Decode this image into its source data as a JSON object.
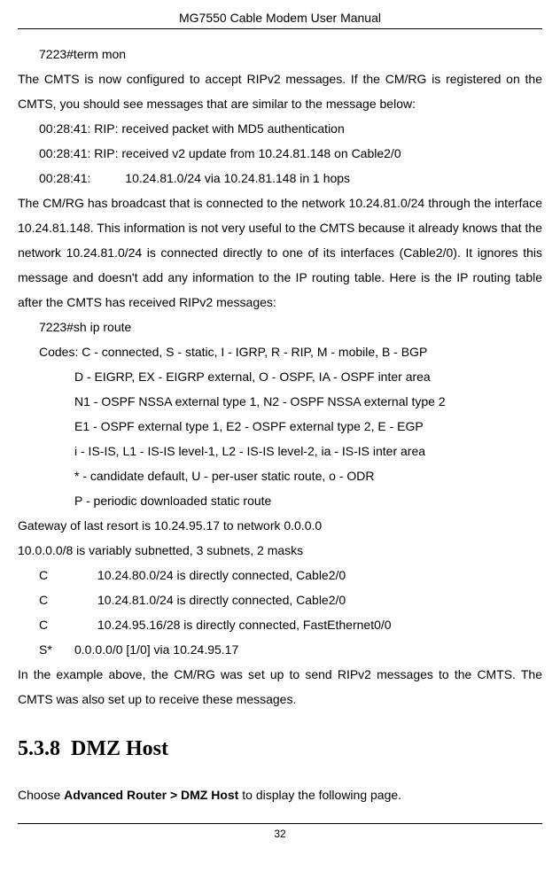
{
  "header": {
    "title": "MG7550 Cable Modem User Manual"
  },
  "body": {
    "line1": "7223#term mon",
    "para1": "The CMTS is now configured to accept RIPv2 messages. If the CM/RG is registered on the CMTS, you should see messages that are similar to the message below:",
    "log1": "00:28:41: RIP: received packet with MD5 authentication",
    "log2": "00:28:41: RIP: received v2 update from 10.24.81.148 on Cable2/0",
    "log3a": "00:28:41:",
    "log3b": "10.24.81.0/24 via 10.24.81.148 in 1 hops",
    "para2": "The CM/RG   has broadcast that is connected to the network 10.24.81.0/24 through the interface 10.24.81.148. This information is not very useful to the CMTS because it already knows that the network 10.24.81.0/24 is connected directly to one of its interfaces (Cable2/0). It ignores this message and doesn't add any information to the IP routing table. Here is the IP routing table after the CMTS has received RIPv2 messages:",
    "cmd2": "7223#sh ip route",
    "codes1": "Codes: C - connected, S - static, I - IGRP, R - RIP, M - mobile, B - BGP",
    "codes2": "D - EIGRP, EX - EIGRP external, O - OSPF, IA - OSPF inter area",
    "codes3": "N1 - OSPF NSSA external type 1, N2 - OSPF NSSA external type 2",
    "codes4": "E1 - OSPF external type 1, E2 - OSPF external type 2, E - EGP",
    "codes5": "i - IS-IS, L1 - IS-IS level-1, L2 - IS-IS level-2, ia - IS-IS inter area",
    "codes6": "* - candidate default, U - per-user static route, o - ODR",
    "codes7": "P - periodic downloaded static route",
    "gw": "Gateway of last resort is 10.24.95.17 to network 0.0.0.0",
    "subnets": "10.0.0.0/8 is variably subnetted, 3 subnets, 2 masks",
    "r1code": "C",
    "r1": "10.24.80.0/24 is directly connected, Cable2/0",
    "r2code": "C",
    "r2": "10.24.81.0/24 is directly connected, Cable2/0",
    "r3code": "C",
    "r3": "10.24.95.16/28 is directly connected, FastEthernet0/0",
    "r4code": "S*",
    "r4": "0.0.0.0/0 [1/0] via 10.24.95.17",
    "para3": "In the example above, the CM/RG was set up to send RIPv2 messages to the CMTS. The CMTS was also set up to receive these messages.",
    "sectionNum": "5.3.8",
    "sectionTitle": "DMZ Host",
    "choose1": "Choose ",
    "choose2": "Advanced Router > DMZ Host",
    "choose3": " to display the following page."
  },
  "footer": {
    "pageNum": "32"
  }
}
